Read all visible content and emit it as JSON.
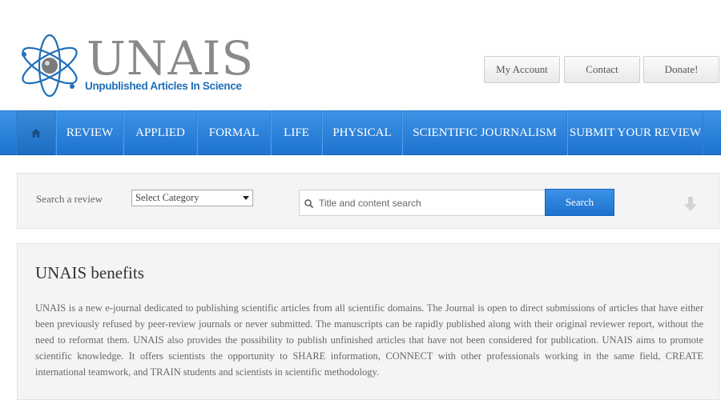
{
  "header": {
    "logo_word": "UNAIS",
    "logo_tagline": "Unpublished Articles In Science",
    "buttons": {
      "my_account": "My Account",
      "contact": "Contact",
      "donate": "Donate!"
    }
  },
  "nav": {
    "home_icon": "home-icon",
    "items": [
      "REVIEW",
      "APPLIED",
      "FORMAL",
      "LIFE",
      "PHYSICAL",
      "SCIENTIFIC JOURNALISM",
      "SUBMIT YOUR REVIEW"
    ]
  },
  "search": {
    "label": "Search a review",
    "category_selected": "Select Category",
    "input_placeholder": "Title and content search",
    "button_label": "Search"
  },
  "benefits": {
    "title": "UNAIS benefits",
    "text": "UNAIS is a new e-journal dedicated to publishing scientific articles from all scientific domains. The Journal is open to direct submissions of articles that have either been previously refused by peer-review journals or never submitted. The manuscripts can be rapidly published along with their original reviewer report, without the need to reformat them. UNAIS also provides the possibility to publish unfinished articles that have not been considered for publication. UNAIS aims to promote scientific knowledge. It offers scientists the opportunity to SHARE information, CONNECT with other professionals working in the same field, CREATE international teamwork, and TRAIN students and scientists in scientific methodology."
  },
  "colors": {
    "nav_blue": "#2a82da",
    "logo_blue": "#1f6fb8",
    "logo_gray": "#8a8a8a"
  }
}
